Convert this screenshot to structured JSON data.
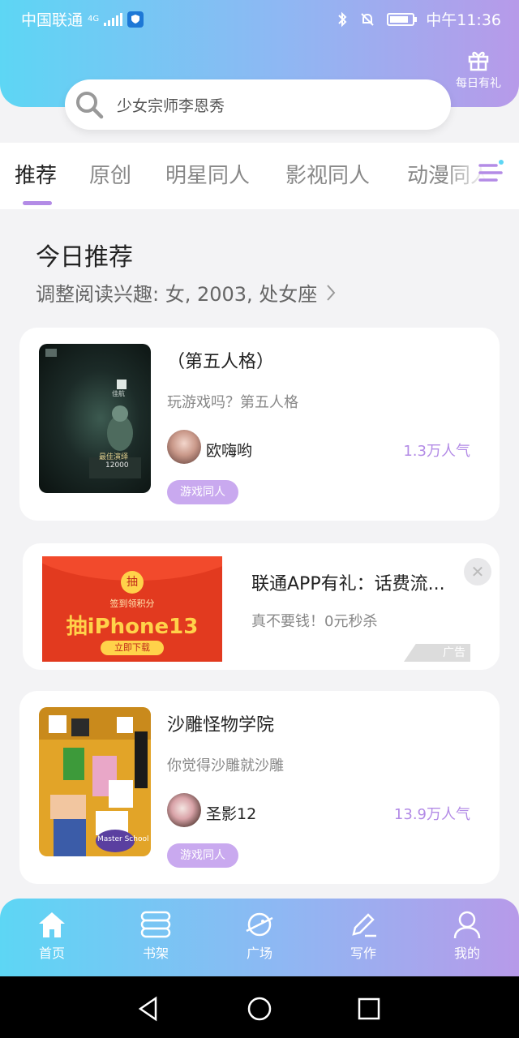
{
  "status_bar": {
    "carrier": "中国联通",
    "network": "4G",
    "time": "中午11:36"
  },
  "header": {
    "gift_label": "每日有礼",
    "search_placeholder": "少女宗师李恩秀"
  },
  "tabs": [
    {
      "label": "推荐",
      "active": true
    },
    {
      "label": "原创",
      "active": false
    },
    {
      "label": "明星同人",
      "active": false
    },
    {
      "label": "影视同人",
      "active": false
    },
    {
      "label": "动漫同人",
      "active": false
    }
  ],
  "section": {
    "title": "今日推荐",
    "subtitle": "调整阅读兴趣: 女, 2003, 处女座"
  },
  "books": [
    {
      "title": "（第五人格）",
      "description": "玩游戏吗？第五人格",
      "author": "欧嗨哟",
      "popularity": "1.3万人气",
      "tag": "游戏同人",
      "cover_text": {
        "top": "佳航",
        "mid": "最佳演绎",
        "num": "12000"
      }
    },
    {
      "title": "沙雕怪物学院",
      "description": "你觉得沙雕就沙雕",
      "author": "圣影12",
      "popularity": "13.9万人气",
      "tag": "游戏同人",
      "cover_text": {
        "scribble": "Master School"
      }
    }
  ],
  "ad": {
    "title": "联通APP有礼：话费流...",
    "description": "真不要钱！0元秒杀",
    "badge": "广告",
    "image_badge": "抽",
    "image_sub": "签到领积分",
    "image_main": "抽iPhone13",
    "image_button": "立即下载"
  },
  "bottom_nav": [
    {
      "label": "首页",
      "icon": "home-icon"
    },
    {
      "label": "书架",
      "icon": "bookshelf-icon"
    },
    {
      "label": "广场",
      "icon": "planet-icon"
    },
    {
      "label": "写作",
      "icon": "pen-icon"
    },
    {
      "label": "我的",
      "icon": "user-icon"
    }
  ],
  "colors": {
    "gradient_start": "#5dd6f4",
    "gradient_end": "#b79ae9",
    "accent": "#b38be6",
    "tag_bg": "#c9a9ef"
  }
}
